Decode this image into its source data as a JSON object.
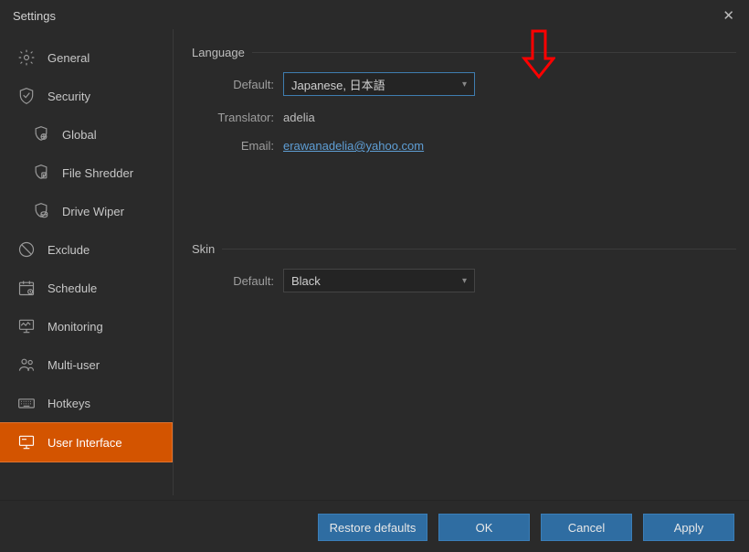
{
  "window": {
    "title": "Settings"
  },
  "sidebar": {
    "items": [
      {
        "label": "General"
      },
      {
        "label": "Security"
      },
      {
        "label": "Global"
      },
      {
        "label": "File Shredder"
      },
      {
        "label": "Drive Wiper"
      },
      {
        "label": "Exclude"
      },
      {
        "label": "Schedule"
      },
      {
        "label": "Monitoring"
      },
      {
        "label": "Multi-user"
      },
      {
        "label": "Hotkeys"
      },
      {
        "label": "User Interface"
      }
    ]
  },
  "content": {
    "sections": {
      "language": {
        "title": "Language",
        "default_label": "Default:",
        "default_value": "Japanese, 日本語",
        "translator_label": "Translator:",
        "translator_value": "adelia",
        "email_label": "Email:",
        "email_value": "erawanadelia@yahoo.com"
      },
      "skin": {
        "title": "Skin",
        "default_label": "Default:",
        "default_value": "Black"
      }
    }
  },
  "buttons": {
    "restore": "Restore defaults",
    "ok": "OK",
    "cancel": "Cancel",
    "apply": "Apply"
  },
  "annotation": {
    "arrow_color": "#ff0000"
  }
}
